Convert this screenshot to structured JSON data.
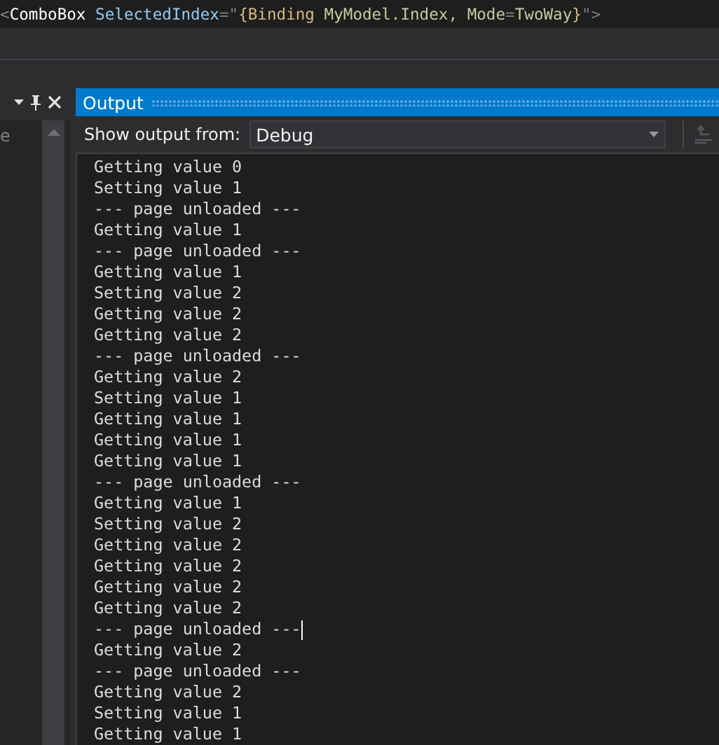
{
  "code_line": [
    {
      "kind": "bracket",
      "text": "<"
    },
    {
      "kind": "element",
      "text": "ComboBox"
    },
    {
      "kind": "attribute",
      "text": " SelectedIndex"
    },
    {
      "kind": "bracket",
      "text": "=\""
    },
    {
      "kind": "markup",
      "text": "{Binding"
    },
    {
      "kind": "value",
      "text": " MyModel.Index, "
    },
    {
      "kind": "value",
      "text": "Mode"
    },
    {
      "kind": "bracket",
      "text": "="
    },
    {
      "kind": "value",
      "text": "TwoWay"
    },
    {
      "kind": "markup",
      "text": "}"
    },
    {
      "kind": "bracket",
      "text": "\">"
    }
  ],
  "side_panel": {
    "label": "e"
  },
  "output": {
    "title": "Output",
    "source_label": "Show output from:",
    "source_value": "Debug",
    "lines": [
      {
        "text": "Getting value 0",
        "caret": false
      },
      {
        "text": "Setting value 1",
        "caret": false
      },
      {
        "text": "--- page unloaded ---",
        "caret": false
      },
      {
        "text": "Getting value 1",
        "caret": false
      },
      {
        "text": "--- page unloaded ---",
        "caret": false
      },
      {
        "text": "Getting value 1",
        "caret": false
      },
      {
        "text": "Setting value 2",
        "caret": false
      },
      {
        "text": "Getting value 2",
        "caret": false
      },
      {
        "text": "Getting value 2",
        "caret": false
      },
      {
        "text": "--- page unloaded ---",
        "caret": false
      },
      {
        "text": "Getting value 2",
        "caret": false
      },
      {
        "text": "Setting value 1",
        "caret": false
      },
      {
        "text": "Getting value 1",
        "caret": false
      },
      {
        "text": "Getting value 1",
        "caret": false
      },
      {
        "text": "Getting value 1",
        "caret": false
      },
      {
        "text": "--- page unloaded ---",
        "caret": false
      },
      {
        "text": "Getting value 1",
        "caret": false
      },
      {
        "text": "Setting value 2",
        "caret": false
      },
      {
        "text": "Getting value 2",
        "caret": false
      },
      {
        "text": "Getting value 2",
        "caret": false
      },
      {
        "text": "Getting value 2",
        "caret": false
      },
      {
        "text": "Getting value 2",
        "caret": false
      },
      {
        "text": "--- page unloaded ---",
        "caret": true
      },
      {
        "text": "Getting value 2",
        "caret": false
      },
      {
        "text": "--- page unloaded ---",
        "caret": false
      },
      {
        "text": "Getting value 2",
        "caret": false
      },
      {
        "text": "Setting value 1",
        "caret": false
      },
      {
        "text": "Getting value 1",
        "caret": false
      }
    ]
  }
}
